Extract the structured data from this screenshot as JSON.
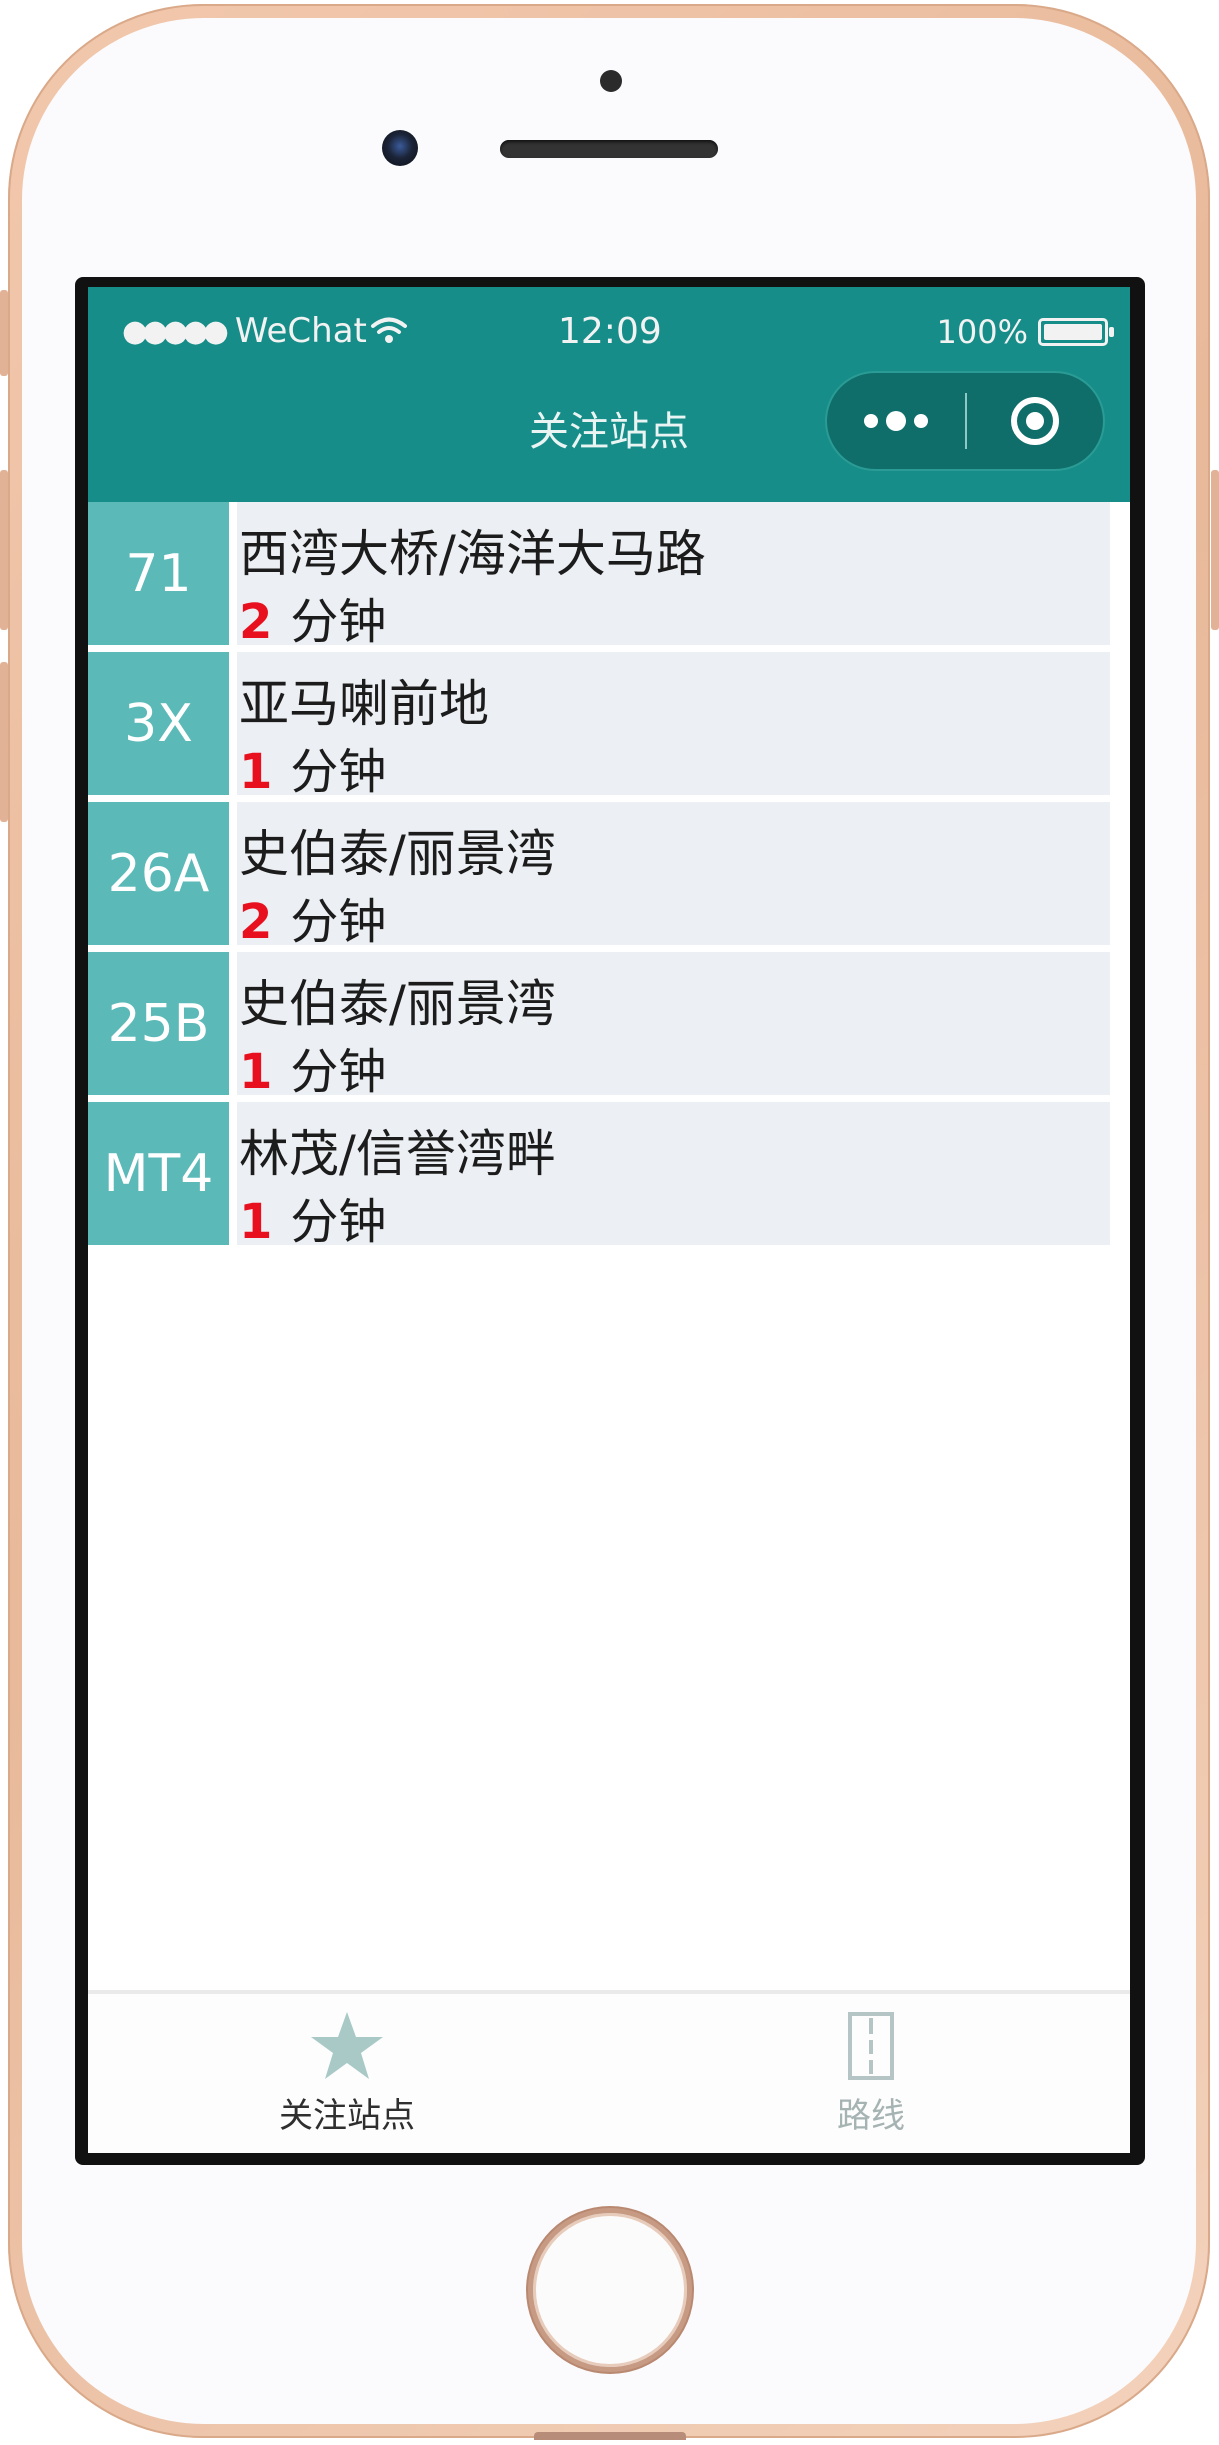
{
  "status_bar": {
    "signal": "●●●●●",
    "carrier": "WeChat",
    "time": "12:09",
    "battery": "100%"
  },
  "nav": {
    "title": "关注站点"
  },
  "favorites": [
    {
      "route": "71",
      "stop": "西湾大桥/海洋大马路",
      "eta_value": "2",
      "eta_unit": "分钟"
    },
    {
      "route": "3X",
      "stop": "亚马喇前地",
      "eta_value": "1",
      "eta_unit": "分钟"
    },
    {
      "route": "26A",
      "stop": "史伯泰/丽景湾",
      "eta_value": "2",
      "eta_unit": "分钟"
    },
    {
      "route": "25B",
      "stop": "史伯泰/丽景湾",
      "eta_value": "1",
      "eta_unit": "分钟"
    },
    {
      "route": "MT4",
      "stop": "林茂/信誉湾畔",
      "eta_value": "1",
      "eta_unit": "分钟"
    }
  ],
  "tabbar": {
    "items": [
      {
        "label": "关注站点",
        "icon": "star-icon",
        "active": true
      },
      {
        "label": "路线",
        "icon": "route-icon",
        "active": false
      }
    ]
  },
  "colors": {
    "header": "#168d88",
    "badge": "#5bb9b8",
    "row_bg": "#eceff3",
    "eta_highlight": "#e8101e"
  }
}
